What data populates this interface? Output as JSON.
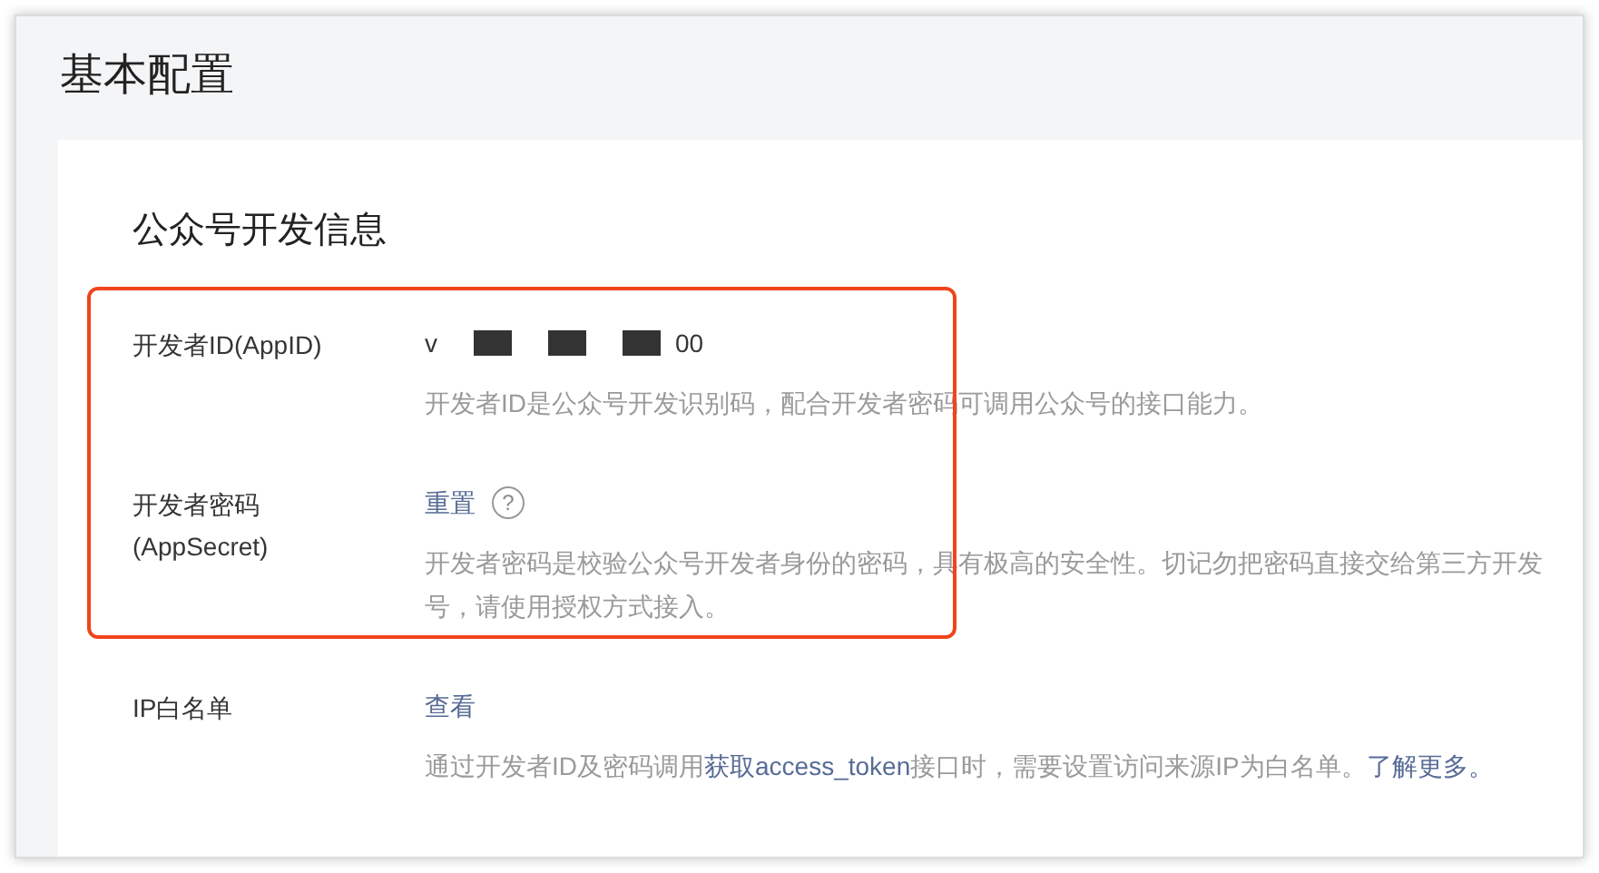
{
  "page_title": "基本配置",
  "section_title": "公众号开发信息",
  "rows": [
    {
      "kind": "value",
      "label_lines": [
        "开发者ID(AppID)"
      ],
      "value_start": "v",
      "value_end": "00",
      "redacted": true,
      "desc_lines": [
        [
          {
            "kind": "text",
            "text": "开发者ID是公众号开发识别码，配合开发者密码可调用公众号的接口能力。"
          }
        ]
      ]
    },
    {
      "kind": "link",
      "label_lines": [
        "开发者密码",
        "(AppSecret)"
      ],
      "link": "重置",
      "help": "?",
      "desc_lines": [
        [
          {
            "kind": "text",
            "text": "开发者密码是校验公众号开发者身份的密码，具有极高的安全性。切记勿把密码直接交给第三方开发"
          }
        ],
        [
          {
            "kind": "text",
            "text": "号，请使用授权方式接入。"
          }
        ]
      ]
    },
    {
      "kind": "link",
      "label_lines": [
        "IP白名单"
      ],
      "link": "查看",
      "desc_lines": [
        [
          {
            "kind": "text",
            "text": "通过开发者ID及密码调用"
          },
          {
            "kind": "link",
            "text": "获取access_token"
          },
          {
            "kind": "text",
            "text": "接口时，需要设置访问来源IP为白名单。"
          },
          {
            "kind": "link",
            "text": "了解更多。"
          }
        ]
      ]
    }
  ],
  "highlight": {
    "shown": true
  }
}
